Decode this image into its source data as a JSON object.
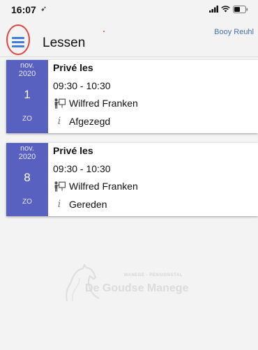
{
  "status_bar": {
    "time": "16:07",
    "location_glyph": "➶",
    "icons": [
      "signal-icon",
      "wifi-icon",
      "battery-icon"
    ]
  },
  "header": {
    "menu_icon": "hamburger-menu-icon",
    "title": "Lessen",
    "user_name": "Booy Reuhl"
  },
  "colors": {
    "date_block": "#5860c0",
    "menu_icon": "#3f7be0",
    "highlight_circle": "#e2453f",
    "user_name": "#4a6fb5"
  },
  "lessons": [
    {
      "month": "nov.",
      "year": "2020",
      "day": "1",
      "weekday": "ZO",
      "type": "Privé les",
      "time": "09:30 - 10:30",
      "teacher_icon": "instructor-icon",
      "teacher": "Wilfred Franken",
      "status_icon": "info-icon",
      "status": "Afgezegd"
    },
    {
      "month": "nov.",
      "year": "2020",
      "day": "8",
      "weekday": "ZO",
      "type": "Privé les",
      "time": "09:30 - 10:30",
      "teacher_icon": "instructor-icon",
      "teacher": "Wilfred Franken",
      "status_icon": "info-icon",
      "status": "Gereden"
    }
  ],
  "watermark": {
    "logo_icon": "horse-logo-icon",
    "subtitle": "MANEGE - PENSIONSTAL",
    "title": "De Goudse Manege"
  }
}
